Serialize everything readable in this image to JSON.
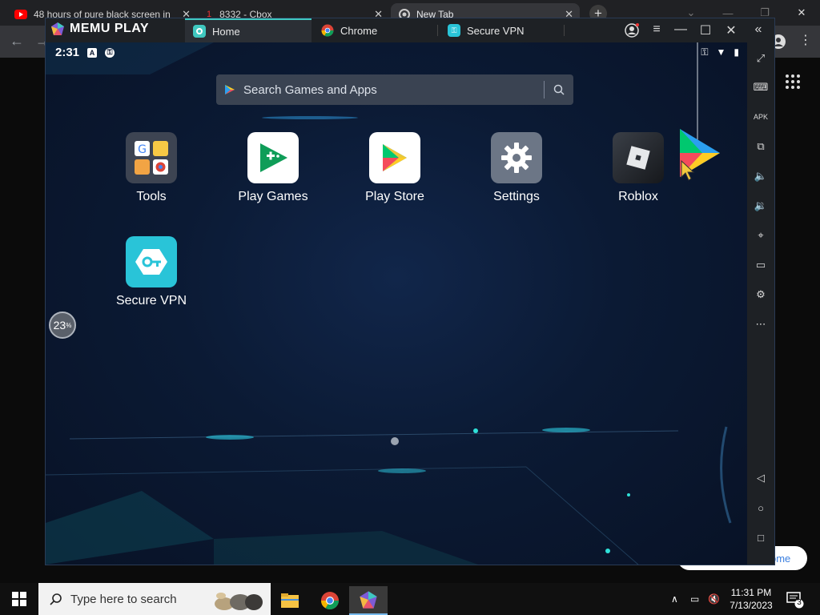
{
  "browser": {
    "tabs": [
      {
        "label": "48 hours of pure black screen in"
      },
      {
        "label": "8332 - Cbox"
      },
      {
        "label": "New Tab"
      }
    ]
  },
  "memu": {
    "logo_text": "MEMU PLAY",
    "tabs": [
      {
        "label": "Home"
      },
      {
        "label": "Chrome"
      },
      {
        "label": "Secure VPN"
      }
    ]
  },
  "android": {
    "time": "2:31",
    "search_placeholder": "Search Games and Apps",
    "apps": [
      {
        "label": "Tools"
      },
      {
        "label": "Play Games"
      },
      {
        "label": "Play Store"
      },
      {
        "label": "Settings"
      },
      {
        "label": "Roblox"
      },
      {
        "label": "Secure VPN"
      }
    ],
    "gauge_value": "23",
    "gauge_unit": "%"
  },
  "chrome_shortcut": {
    "label_fragment": "ome"
  },
  "taskbar": {
    "search_placeholder": "Type here to search",
    "time": "11:31 PM",
    "date": "7/13/2023",
    "notification_count": "3"
  },
  "colors": {
    "memu_accent": "#3fc8c0",
    "screen_bg": "#0c1830",
    "vpn_teal": "#29c4d8"
  }
}
